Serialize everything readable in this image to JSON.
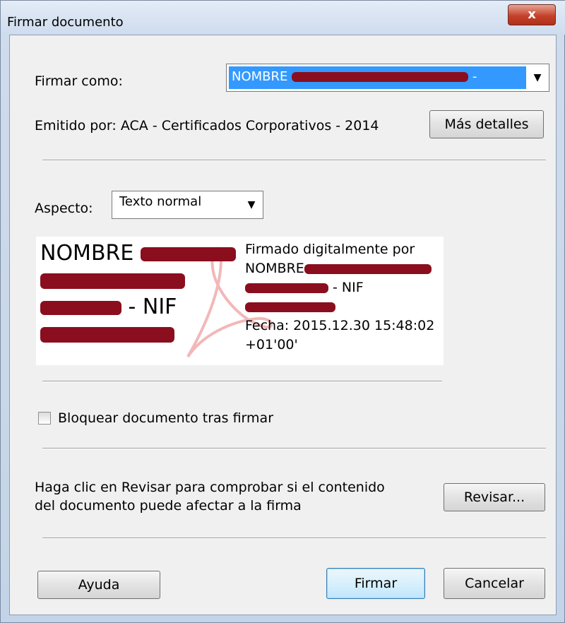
{
  "window": {
    "title": "Firmar documento",
    "close_label": "x"
  },
  "sign_as": {
    "label": "Firmar como:",
    "selected_value": "NOMBRE",
    "selected_suffix": "-"
  },
  "issuer": {
    "text": "Emitido por: ACA - Certificados Corporativos - 2014",
    "details_button": "Más detalles"
  },
  "appearance": {
    "label": "Aspecto:",
    "selected_value": "Texto normal"
  },
  "preview": {
    "left_line1": "NOMBRE",
    "left_line3_suffix": " - NIF",
    "right_line1": "Firmado digitalmente por",
    "right_line2": "NOMBRE",
    "right_line3_suffix": " - NIF",
    "right_line5": "Fecha: 2015.12.30 15:48:02",
    "right_line6": "+01'00'"
  },
  "lock": {
    "label": "Bloquear documento tras firmar",
    "checked": false
  },
  "review": {
    "text_line1": "Haga clic en Revisar para comprobar si el contenido",
    "text_line2": "del documento puede afectar a la firma",
    "button": "Revisar..."
  },
  "footer": {
    "help": "Ayuda",
    "sign": "Firmar",
    "cancel": "Cancelar"
  },
  "colors": {
    "selection": "#3399ff",
    "redaction": "#8b0e1e"
  }
}
